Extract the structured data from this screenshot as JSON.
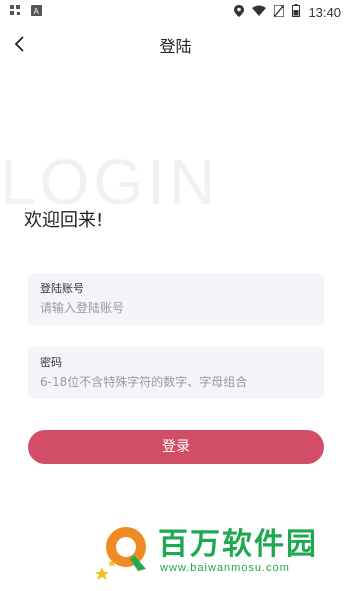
{
  "status_bar": {
    "time": "13:40"
  },
  "header": {
    "title": "登陆"
  },
  "background_word": "LOGIN",
  "welcome": "欢迎回来!",
  "account_field": {
    "label": "登陆账号",
    "placeholder": "请输入登陆账号",
    "value": ""
  },
  "password_field": {
    "label": "密码",
    "placeholder": "6-18位不含特殊字符的数字、字母组合",
    "value": ""
  },
  "login_button": "登录",
  "watermark": {
    "title": "百万软件园",
    "url": "www.baiwanmosu.com"
  },
  "colors": {
    "accent": "#d24e67",
    "field_bg": "#f6f4fa",
    "watermark": "#1fa84f"
  }
}
